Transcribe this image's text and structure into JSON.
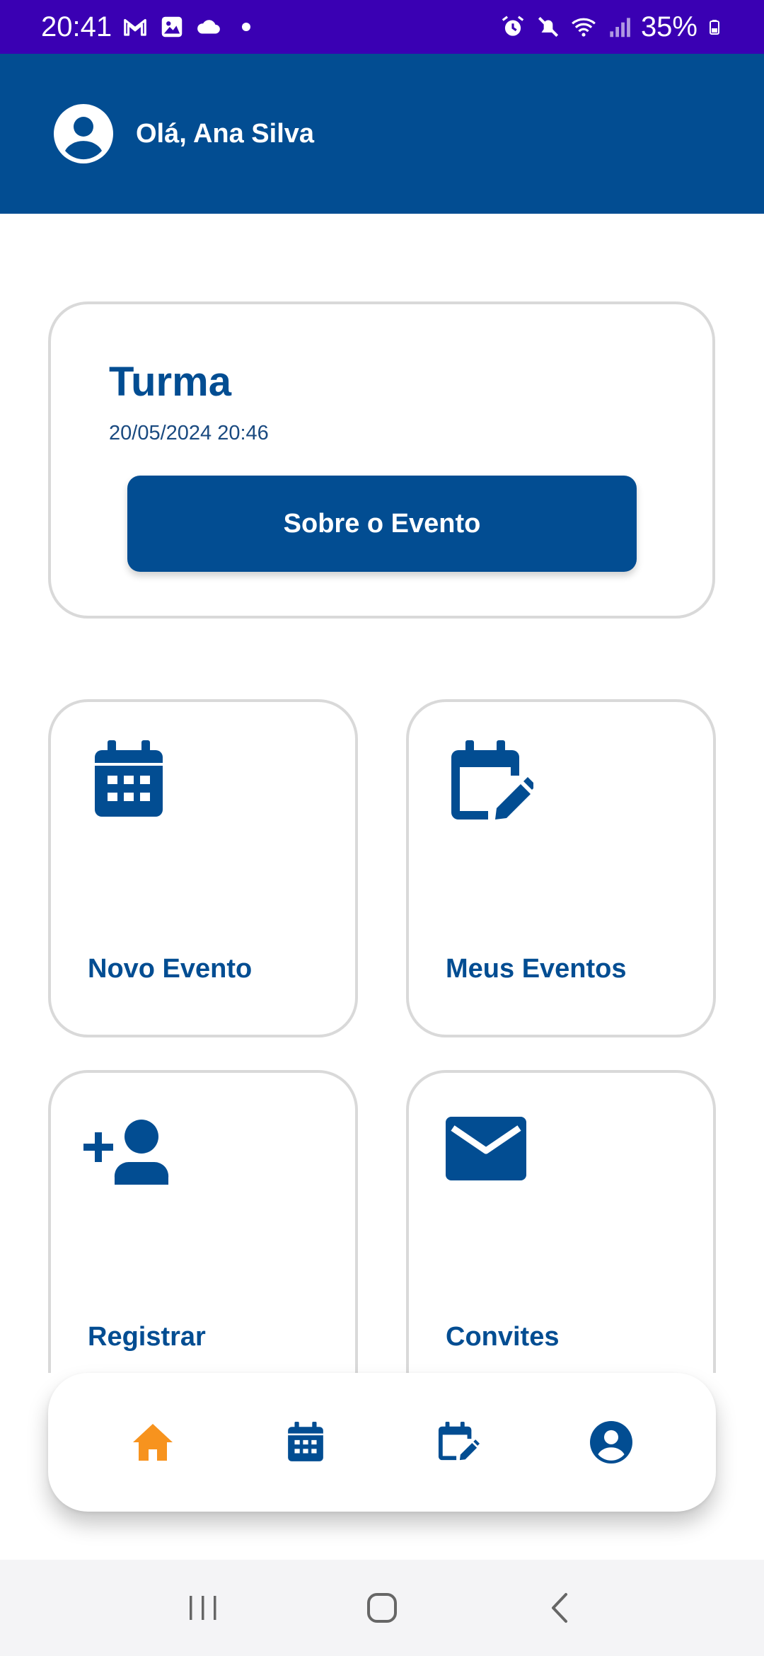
{
  "status_bar": {
    "time": "20:41",
    "battery": "35%",
    "left_icons": [
      "gmail-icon",
      "gallery-icon",
      "cloud-icon",
      "dot-icon"
    ],
    "right_icons": [
      "alarm-icon",
      "mute-icon",
      "wifi-icon",
      "signal-icon",
      "battery-icon"
    ]
  },
  "header": {
    "greeting": "Olá, Ana Silva",
    "avatar_icon": "user-circle-icon",
    "background": "#024d92"
  },
  "event_card": {
    "title": "Turma",
    "datetime": "20/05/2024 20:46",
    "button_label": "Sobre o Evento"
  },
  "tiles": [
    {
      "label": "Novo Evento",
      "icon": "calendar-icon"
    },
    {
      "label": "Meus Eventos",
      "icon": "calendar-edit-icon"
    },
    {
      "label": "Registrar",
      "icon": "add-user-icon"
    },
    {
      "label": "Convites",
      "icon": "envelope-icon"
    }
  ],
  "bottom_nav": {
    "items": [
      {
        "icon": "home-icon",
        "active": true
      },
      {
        "icon": "calendar-icon",
        "active": false
      },
      {
        "icon": "calendar-edit-icon",
        "active": false
      },
      {
        "icon": "user-circle-icon",
        "active": false
      }
    ],
    "active_color": "#f7931e",
    "inactive_color": "#024d92"
  },
  "system_nav": {
    "buttons": [
      "recents-icon",
      "home-icon",
      "back-icon"
    ]
  },
  "colors": {
    "status_bar": "#3a00b3",
    "primary": "#024d92",
    "accent": "#f7931e",
    "card_border": "#d9d9d9"
  }
}
